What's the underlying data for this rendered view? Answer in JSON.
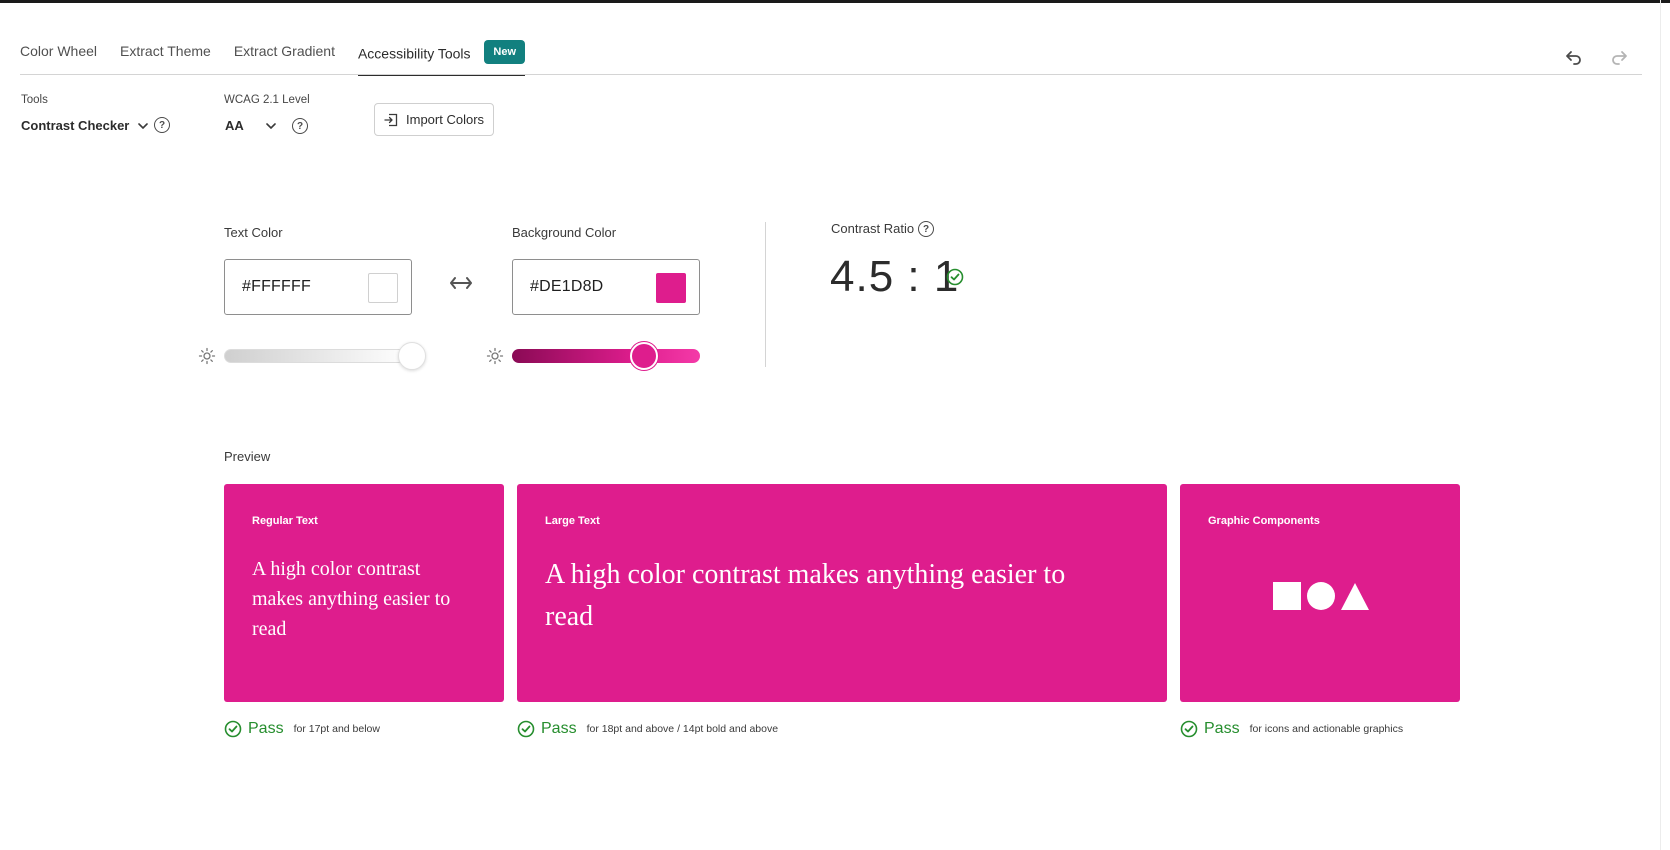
{
  "tabs": [
    {
      "label": "Color Wheel"
    },
    {
      "label": "Extract Theme"
    },
    {
      "label": "Extract Gradient"
    },
    {
      "label": "Accessibility Tools",
      "badge": "New",
      "active": true
    }
  ],
  "toolbar": {
    "undo_icon": "undo-icon",
    "redo_icon": "redo-icon"
  },
  "tools": {
    "label": "Tools",
    "selected": "Contrast Checker",
    "help": "?"
  },
  "wcag": {
    "label": "WCAG 2.1 Level",
    "selected": "AA",
    "help": "?"
  },
  "import_button": {
    "label": "Import Colors",
    "icon": "import-icon"
  },
  "text_color": {
    "label": "Text Color",
    "value": "#FFFFFF",
    "swatch": "#ffffff",
    "brightness": 1.0
  },
  "background_color": {
    "label": "Background Color",
    "value": "#DE1D8D",
    "swatch": "#de1d8d",
    "brightness": 0.7
  },
  "contrast": {
    "label": "Contrast Ratio",
    "help": "?",
    "value": "4.5 : 1",
    "status": "pass"
  },
  "preview": {
    "label": "Preview",
    "cards": [
      {
        "title": "Regular Text",
        "text": "A high color contrast makes anything easier to read",
        "result": "Pass",
        "note": "for 17pt and below"
      },
      {
        "title": "Large Text",
        "text": "A high color contrast makes anything easier to read",
        "result": "Pass",
        "note": "for 18pt and above / 14pt bold and above"
      },
      {
        "title": "Graphic Components",
        "shapes": [
          "square",
          "circle",
          "triangle"
        ],
        "result": "Pass",
        "note": "for icons and actionable graphics"
      }
    ]
  },
  "colors": {
    "accent": "#de1d8d",
    "badge": "#12807f",
    "pass": "#268e2e"
  }
}
